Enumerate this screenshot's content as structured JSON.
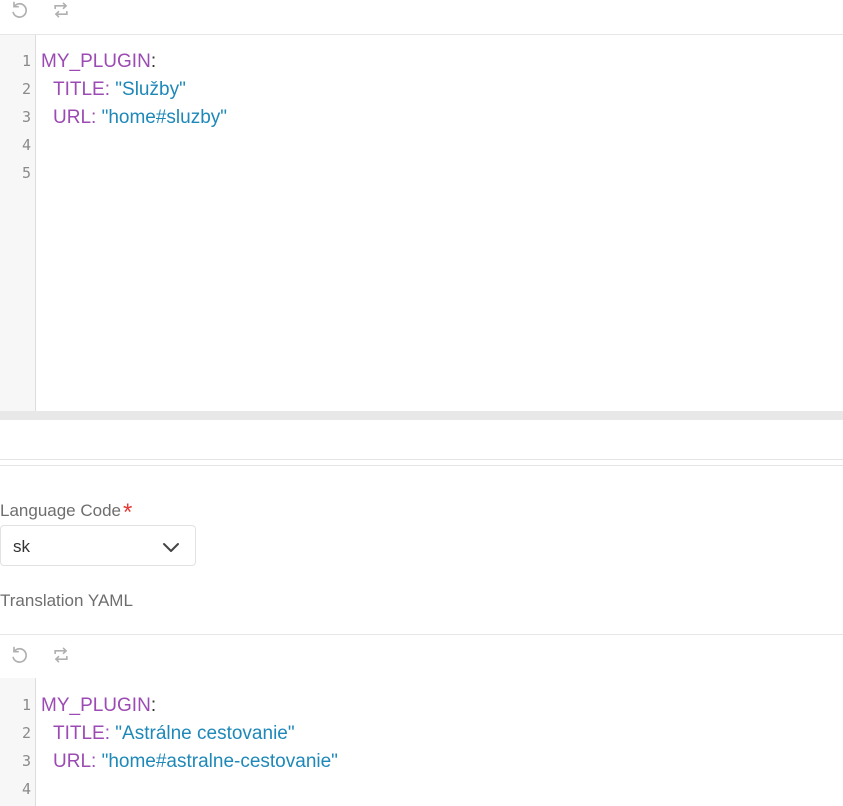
{
  "editor_top": {
    "lines": [
      {
        "number": "1",
        "key": "MY_PLUGIN",
        "sep": ":",
        "value": ""
      },
      {
        "number": "2",
        "key": "TITLE",
        "sep": ": ",
        "value": "\"Služby\""
      },
      {
        "number": "3",
        "key": "URL",
        "sep": ": ",
        "value": "\"home#sluzby\""
      },
      {
        "number": "4",
        "key": "",
        "sep": "",
        "value": ""
      },
      {
        "number": "5",
        "key": "",
        "sep": "",
        "value": ""
      }
    ]
  },
  "form": {
    "language_code_label": "Language Code",
    "required_mark": "*",
    "language_code_value": "sk",
    "translation_yaml_label": "Translation YAML"
  },
  "editor_bottom": {
    "lines": [
      {
        "number": "1",
        "key": "MY_PLUGIN",
        "sep": ":",
        "value": ""
      },
      {
        "number": "2",
        "key": "TITLE",
        "sep": ": ",
        "value": "\"Astrálne cestovanie\""
      },
      {
        "number": "3",
        "key": "URL",
        "sep": ": ",
        "value": "\"home#astralne-cestovanie\""
      },
      {
        "number": "4",
        "key": "",
        "sep": "",
        "value": ""
      }
    ]
  },
  "icons": {
    "undo": "undo-icon",
    "redo": "redo-icon",
    "dropdown": "chevron-down-icon"
  },
  "colors": {
    "yaml_key": "#9b4bb3",
    "yaml_string": "#1e88b8",
    "required": "#e53935"
  }
}
